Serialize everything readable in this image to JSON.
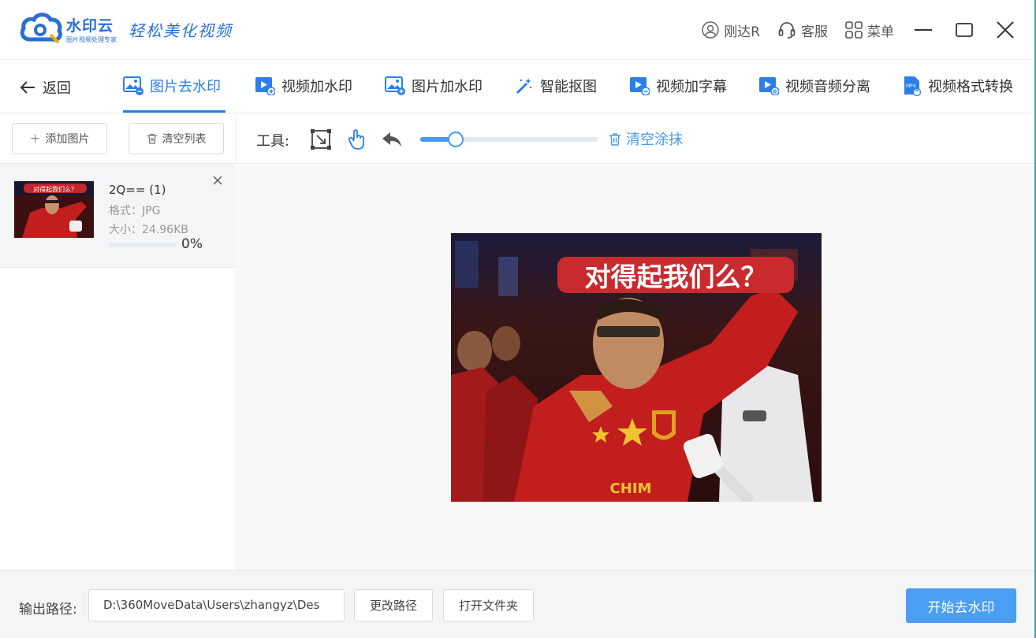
{
  "app": {
    "name": "水印云",
    "subtitle": "图片视频处理专家",
    "slogan": "轻松美化视频"
  },
  "titlebar": {
    "user_label": "刚达R",
    "service_label": "客服",
    "menu_label": "菜单"
  },
  "nav": {
    "back_label": "返回",
    "tabs": [
      {
        "label": "图片去水印",
        "active": true
      },
      {
        "label": "视频加水印",
        "active": false
      },
      {
        "label": "图片加水印",
        "active": false
      },
      {
        "label": "智能抠图",
        "active": false
      },
      {
        "label": "视频加字幕",
        "active": false
      },
      {
        "label": "视频音频分离",
        "active": false
      },
      {
        "label": "视频格式转换",
        "active": false
      }
    ]
  },
  "left_panel": {
    "add_label": "添加图片",
    "clear_label": "清空列表",
    "file": {
      "name": "2Q== (1)",
      "format": "格式：JPG",
      "size": "大小：24.96KB",
      "progress": 0,
      "progress_text": "0%",
      "thumb_caption": "对得起我们么？"
    }
  },
  "toolbar": {
    "label": "工具:",
    "brush_level": 0.2,
    "clear_paint_label": "清空涂抹"
  },
  "preview": {
    "caption": "对得起我们么？",
    "shirt_text": "CHIM"
  },
  "footer": {
    "output_label": "输出路径:",
    "output_path": "D:\\360MoveData\\Users\\zhangyz\\Des",
    "change_path_label": "更改路径",
    "open_folder_label": "打开文件夹",
    "start_label": "开始去水印"
  },
  "colors": {
    "accent": "#2a7fe8",
    "start_button": "#4a9ef3"
  }
}
